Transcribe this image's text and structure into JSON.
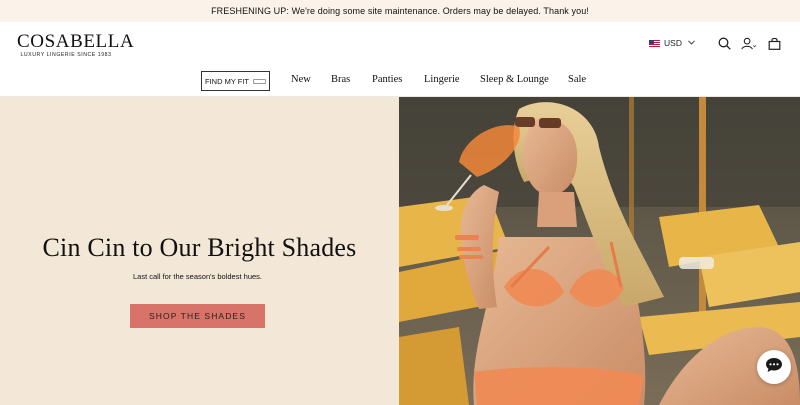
{
  "announcement": {
    "text": "FRESHENING UP: We're doing some site maintenance. Orders may be delayed. Thank you!"
  },
  "header": {
    "logo_word": "COSABELLA",
    "logo_tagline": "LUXURY LINGERIE SINCE 1983",
    "currency": "USD",
    "icons": [
      "us-flag-icon",
      "chevron-down-icon",
      "search-icon",
      "account-icon",
      "bag-icon"
    ]
  },
  "nav": {
    "fit_label": "FIND MY FIT",
    "items": [
      {
        "label": "New"
      },
      {
        "label": "Bras"
      },
      {
        "label": "Panties"
      },
      {
        "label": "Lingerie"
      },
      {
        "label": "Sleep & Lounge"
      },
      {
        "label": "Sale"
      }
    ]
  },
  "hero": {
    "title": "Cin Cin to Our Bright Shades",
    "subtitle": "Last call for the season's boldest hues.",
    "cta": "SHOP THE SHADES",
    "accent": "#d8736a",
    "panel_color": "#f3e8d7"
  },
  "chat": {
    "icon": "chat-bubble-icon"
  }
}
